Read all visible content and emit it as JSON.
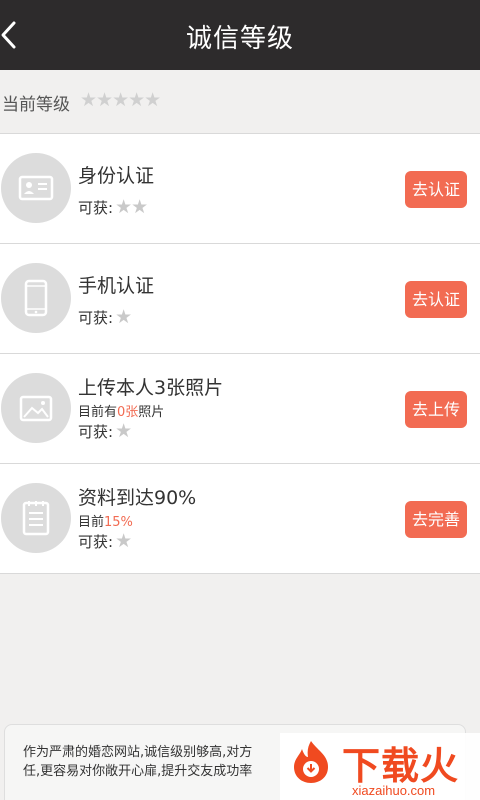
{
  "header": {
    "title": "诚信等级"
  },
  "level": {
    "label": "当前等级",
    "stars": "★★★★★"
  },
  "items": [
    {
      "icon": "id-card-icon",
      "title": "身份认证",
      "gain_label": "可获:",
      "gain_stars": "★★",
      "button": "去认证"
    },
    {
      "icon": "phone-icon",
      "title": "手机认证",
      "gain_label": "可获:",
      "gain_stars": "★",
      "button": "去认证"
    },
    {
      "icon": "photo-icon",
      "title": "上传本人3张照片",
      "sub_prefix": "目前有",
      "sub_value": "0张",
      "sub_suffix": "照片",
      "gain_label": "可获:",
      "gain_stars": "★",
      "button": "去上传"
    },
    {
      "icon": "document-icon",
      "title": "资料到达90%",
      "sub_prefix": "目前",
      "sub_value": "15%",
      "sub_suffix": "",
      "gain_label": "可获:",
      "gain_stars": "★",
      "button": "去完善"
    }
  ],
  "info": {
    "line1": "作为严肃的婚恋网站,诚信级别够高,对方",
    "line2": "任,更容易对你敞开心扉,提升交友成功率"
  },
  "watermark": {
    "brand": "下载火",
    "domain": "xiazaihuo.com"
  },
  "colors": {
    "header_bg": "#2d2b2c",
    "accent": "#f26b52",
    "page_bg": "#f1f0ef",
    "star_inactive": "#c9c9c9"
  }
}
